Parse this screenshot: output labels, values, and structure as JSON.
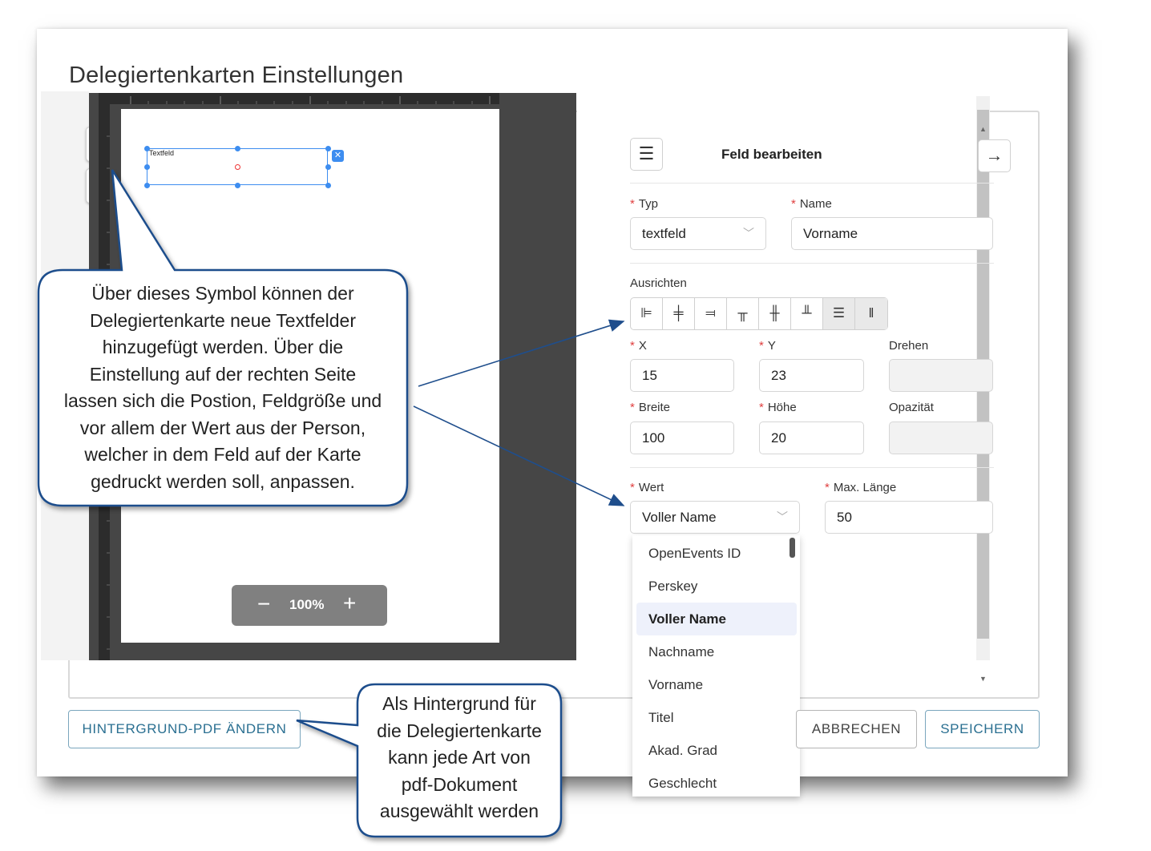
{
  "dialog": {
    "title": "Delegiertenkarten Einstellungen"
  },
  "canvas": {
    "text_box_label": "Textfeld",
    "zoom_minus": "−",
    "zoom_value": "100%",
    "zoom_plus": "+"
  },
  "panel": {
    "title": "Feld bearbeiten",
    "typ_label": "Typ",
    "typ_value": "textfeld",
    "name_label": "Name",
    "name_value": "Vorname",
    "align_label": "Ausrichten",
    "x_label": "X",
    "x_value": "15",
    "y_label": "Y",
    "y_value": "23",
    "drehen_label": "Drehen",
    "breite_label": "Breite",
    "breite_value": "100",
    "hoehe_label": "Höhe",
    "hoehe_value": "20",
    "opazitaet_label": "Opazität",
    "wert_label": "Wert",
    "wert_value": "Voller Name",
    "maxlen_label": "Max. Länge",
    "maxlen_value": "50"
  },
  "dropdown": {
    "options": [
      "OpenEvents ID",
      "Perskey",
      "Voller Name",
      "Nachname",
      "Vorname",
      "Titel",
      "Akad. Grad",
      "Geschlecht"
    ],
    "selected": "Voller Name"
  },
  "buttons": {
    "background_pdf": "HINTERGRUND-PDF ÄNDERN",
    "cancel": "ABBRECHEN",
    "save": "SPEICHERN"
  },
  "callouts": {
    "main_lines": [
      "Über dieses Symbol können der",
      "Delegiertenkarte neue Textfelder",
      "hinzugefügt werden. Über die",
      "Einstellung auf der rechten Seite",
      "lassen sich die Postion, Feldgröße und",
      "vor allem der Wert aus der Person,",
      "welcher in dem Feld auf der Karte",
      "gedruckt werden soll, anpassen."
    ],
    "bottom_lines": [
      "Als Hintergrund für",
      "die Delegiertenkarte",
      "kann jede Art von",
      "pdf-Dokument",
      "ausgewählt werden"
    ]
  },
  "colors": {
    "accent": "#2a6f91",
    "selection": "#3d8df0",
    "callout_border": "#1f4e8c",
    "required": "#e04040"
  }
}
